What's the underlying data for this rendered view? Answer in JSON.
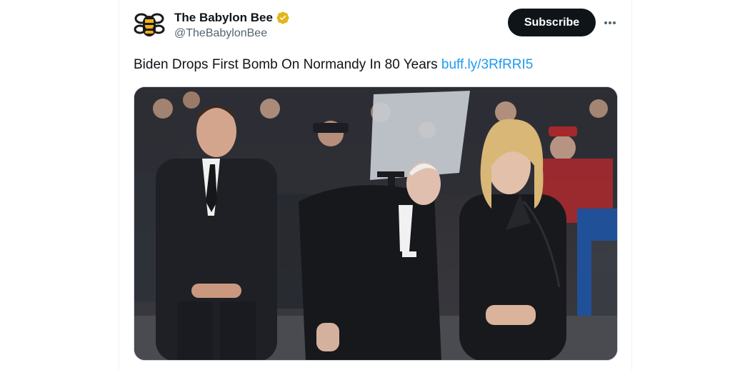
{
  "account": {
    "display_name": "The Babylon Bee",
    "handle": "@TheBabylonBee",
    "verified_color": "#e2b719",
    "avatar_icon": "babylon-bee-logo"
  },
  "actions": {
    "subscribe_label": "Subscribe",
    "more_icon": "more-horizontal-icon"
  },
  "tweet": {
    "text": "Biden Drops First Bomb On Normandy In 80 Years",
    "link_text": "buff.ly/3RfRRI5",
    "link_color": "#1d9bf0"
  },
  "media": {
    "type": "photo",
    "description_hidden": true
  }
}
